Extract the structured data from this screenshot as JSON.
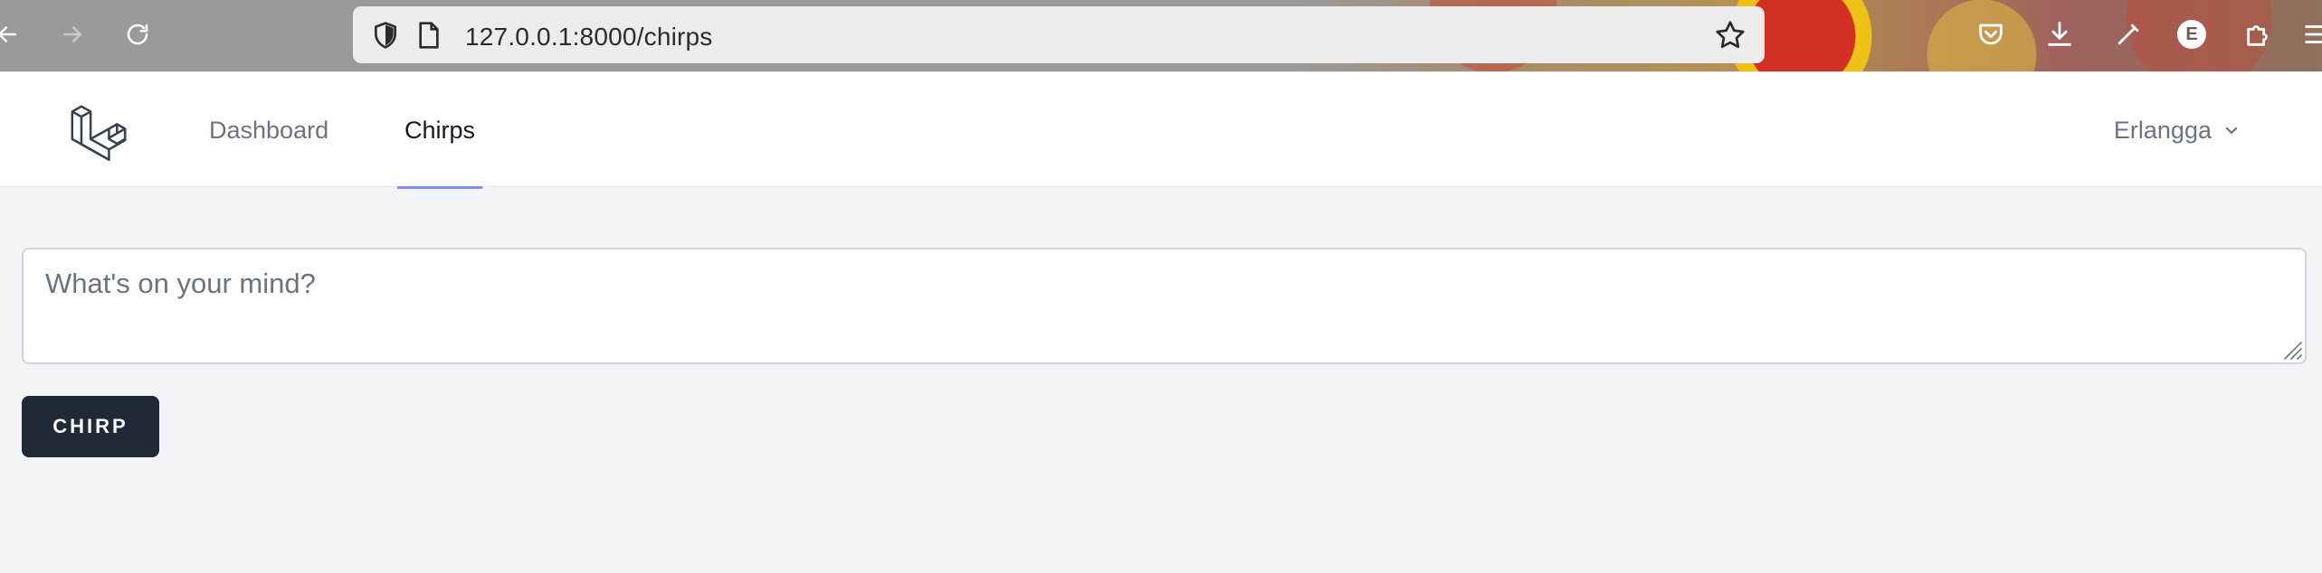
{
  "browser": {
    "url": "127.0.0.1:8000/chirps",
    "back_icon": "arrow-left-icon",
    "forward_icon": "arrow-right-icon",
    "reload_icon": "reload-icon",
    "profile_initial": "E"
  },
  "nav": {
    "links": [
      {
        "label": "Dashboard",
        "active": false
      },
      {
        "label": "Chirps",
        "active": true
      }
    ],
    "user_name": "Erlangga",
    "accent_color": "#818cf8"
  },
  "form": {
    "placeholder": "What's on your mind?",
    "value": "",
    "submit_label": "CHIRP"
  },
  "colors": {
    "page_bg": "#f3f4f6",
    "button_bg": "#1f2937"
  }
}
